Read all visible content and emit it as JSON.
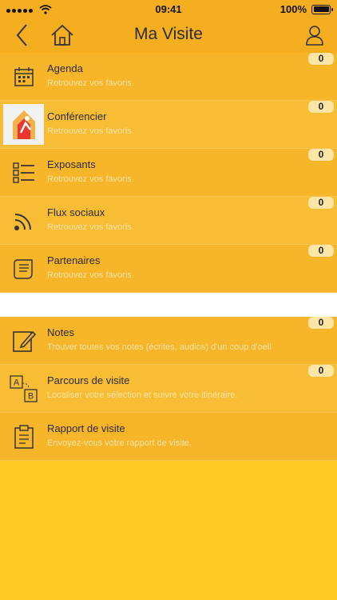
{
  "status_bar": {
    "time": "09:41",
    "battery": "100%"
  },
  "header": {
    "title": "Ma Visite"
  },
  "items": [
    {
      "title": "Agenda",
      "subtitle": "Retrouvez vos favoris.",
      "count": "0",
      "icon": "calendar-icon"
    },
    {
      "title": "Conférencier",
      "subtitle": "Retrouvez vos favoris.",
      "count": "0",
      "icon": "speaker-thumbnail"
    },
    {
      "title": "Exposants",
      "subtitle": "Retrouvez vos favoris.",
      "count": "0",
      "icon": "checklist-icon"
    },
    {
      "title": "Flux sociaux",
      "subtitle": "Retrouvez vos favoris.",
      "count": "0",
      "icon": "rss-icon"
    },
    {
      "title": "Partenaires",
      "subtitle": "Retrouvez vos favoris.",
      "count": "0",
      "icon": "scroll-icon"
    },
    {
      "title": "Notes",
      "subtitle": "Trouver toutes vos notes (écrites, audios) d'un coup d'oeil",
      "count": "0",
      "icon": "edit-note-icon"
    },
    {
      "title": "Parcours de visite",
      "subtitle": "Localiser votre sélection et suivre votre itinéraire.",
      "count": "0",
      "icon": "route-ab-icon"
    },
    {
      "title": "Rapport de visite",
      "subtitle": "Envoyez-vous votre rapport de visite.",
      "icon": "clipboard-icon"
    }
  ],
  "colors": {
    "header": "#f5ae1f",
    "row": "#f7b52a",
    "background": "#ffc926",
    "badge": "#fde6a6"
  }
}
